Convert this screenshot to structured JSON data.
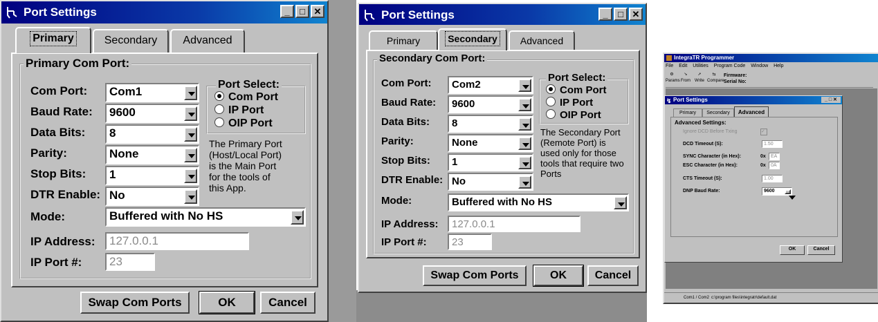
{
  "win1": {
    "title": "Port Settings",
    "tabs": [
      "Primary",
      "Secondary",
      "Advanced"
    ],
    "group_label": "Primary Com Port:",
    "fields": [
      {
        "label": "Com Port:",
        "value": "Com1"
      },
      {
        "label": "Baud Rate:",
        "value": "9600"
      },
      {
        "label": "Data Bits:",
        "value": "8"
      },
      {
        "label": "Parity:",
        "value": "None"
      },
      {
        "label": "Stop Bits:",
        "value": "1"
      },
      {
        "label": "DTR Enable:",
        "value": "No"
      }
    ],
    "mode_label": "Mode:",
    "mode_value": "Buffered with No HS",
    "port_select": {
      "label": "Port Select:",
      "options": [
        "Com Port",
        "IP Port",
        "OIP Port"
      ],
      "selected": "Com Port"
    },
    "note": [
      "The Primary Port",
      "(Host/Local Port)",
      "is the Main Port",
      "for the tools of",
      "this App."
    ],
    "ip_address_label": "IP Address:",
    "ip_address_value": "127.0.0.1",
    "ip_port_label": "IP Port #:",
    "ip_port_value": "23",
    "buttons": {
      "swap": "Swap Com Ports",
      "ok": "OK",
      "cancel": "Cancel"
    }
  },
  "win2": {
    "title": "Port Settings",
    "tabs": [
      "Primary",
      "Secondary",
      "Advanced"
    ],
    "group_label": "Secondary Com Port:",
    "fields": [
      {
        "label": "Com Port:",
        "value": "Com2"
      },
      {
        "label": "Baud Rate:",
        "value": "9600"
      },
      {
        "label": "Data Bits:",
        "value": "8"
      },
      {
        "label": "Parity:",
        "value": "None"
      },
      {
        "label": "Stop Bits:",
        "value": "1"
      },
      {
        "label": "DTR Enable:",
        "value": "No"
      }
    ],
    "mode_label": "Mode:",
    "mode_value": "Buffered with No HS",
    "port_select": {
      "label": "Port Select:",
      "options": [
        "Com Port",
        "IP Port",
        "OIP Port"
      ],
      "selected": "Com Port"
    },
    "note": [
      "The Secondary Port",
      "(Remote Port) is",
      "used only for those",
      "tools that require two",
      "Ports"
    ],
    "ip_address_label": "IP Address:",
    "ip_address_value": "127.0.0.1",
    "ip_port_label": "IP Port #:",
    "ip_port_value": "23",
    "buttons": {
      "swap": "Swap Com Ports",
      "ok": "OK",
      "cancel": "Cancel"
    }
  },
  "app": {
    "title": "IntegraTR Programmer",
    "menu": [
      "File",
      "Edit",
      "Utilities",
      "Program Code",
      "Window",
      "Help"
    ],
    "toolbar": [
      "Params",
      "From",
      "Write",
      "Compare"
    ],
    "firmware_label": "Firmware:",
    "serial_label": "Serial No:",
    "status_ports": "Com1 / Com2",
    "status_path": "c:\\program files\\integratr\\default.dat",
    "dialog": {
      "title": "Port Settings",
      "tabs": [
        "Primary",
        "Secondary",
        "Advanced"
      ],
      "group_label": "Advanced Settings:",
      "ignore_dcd": "Ignore DCD Before Txing",
      "dcd_timeout_label": "DCD Timeout (S):",
      "dcd_timeout_value": "1.50",
      "sync_label": "SYNC Character (in Hex):",
      "sync_prefix": "0x",
      "sync_value": "EA",
      "esc_label": "ESC Character (in Hex):",
      "esc_prefix": "0x",
      "esc_value": "0A",
      "cts_label": "CTS Timeout (S):",
      "cts_value": "1.00",
      "dnp_label": "DNP Baud Rate:",
      "dnp_value": "9600",
      "ok": "OK",
      "cancel": "Cancel"
    }
  }
}
